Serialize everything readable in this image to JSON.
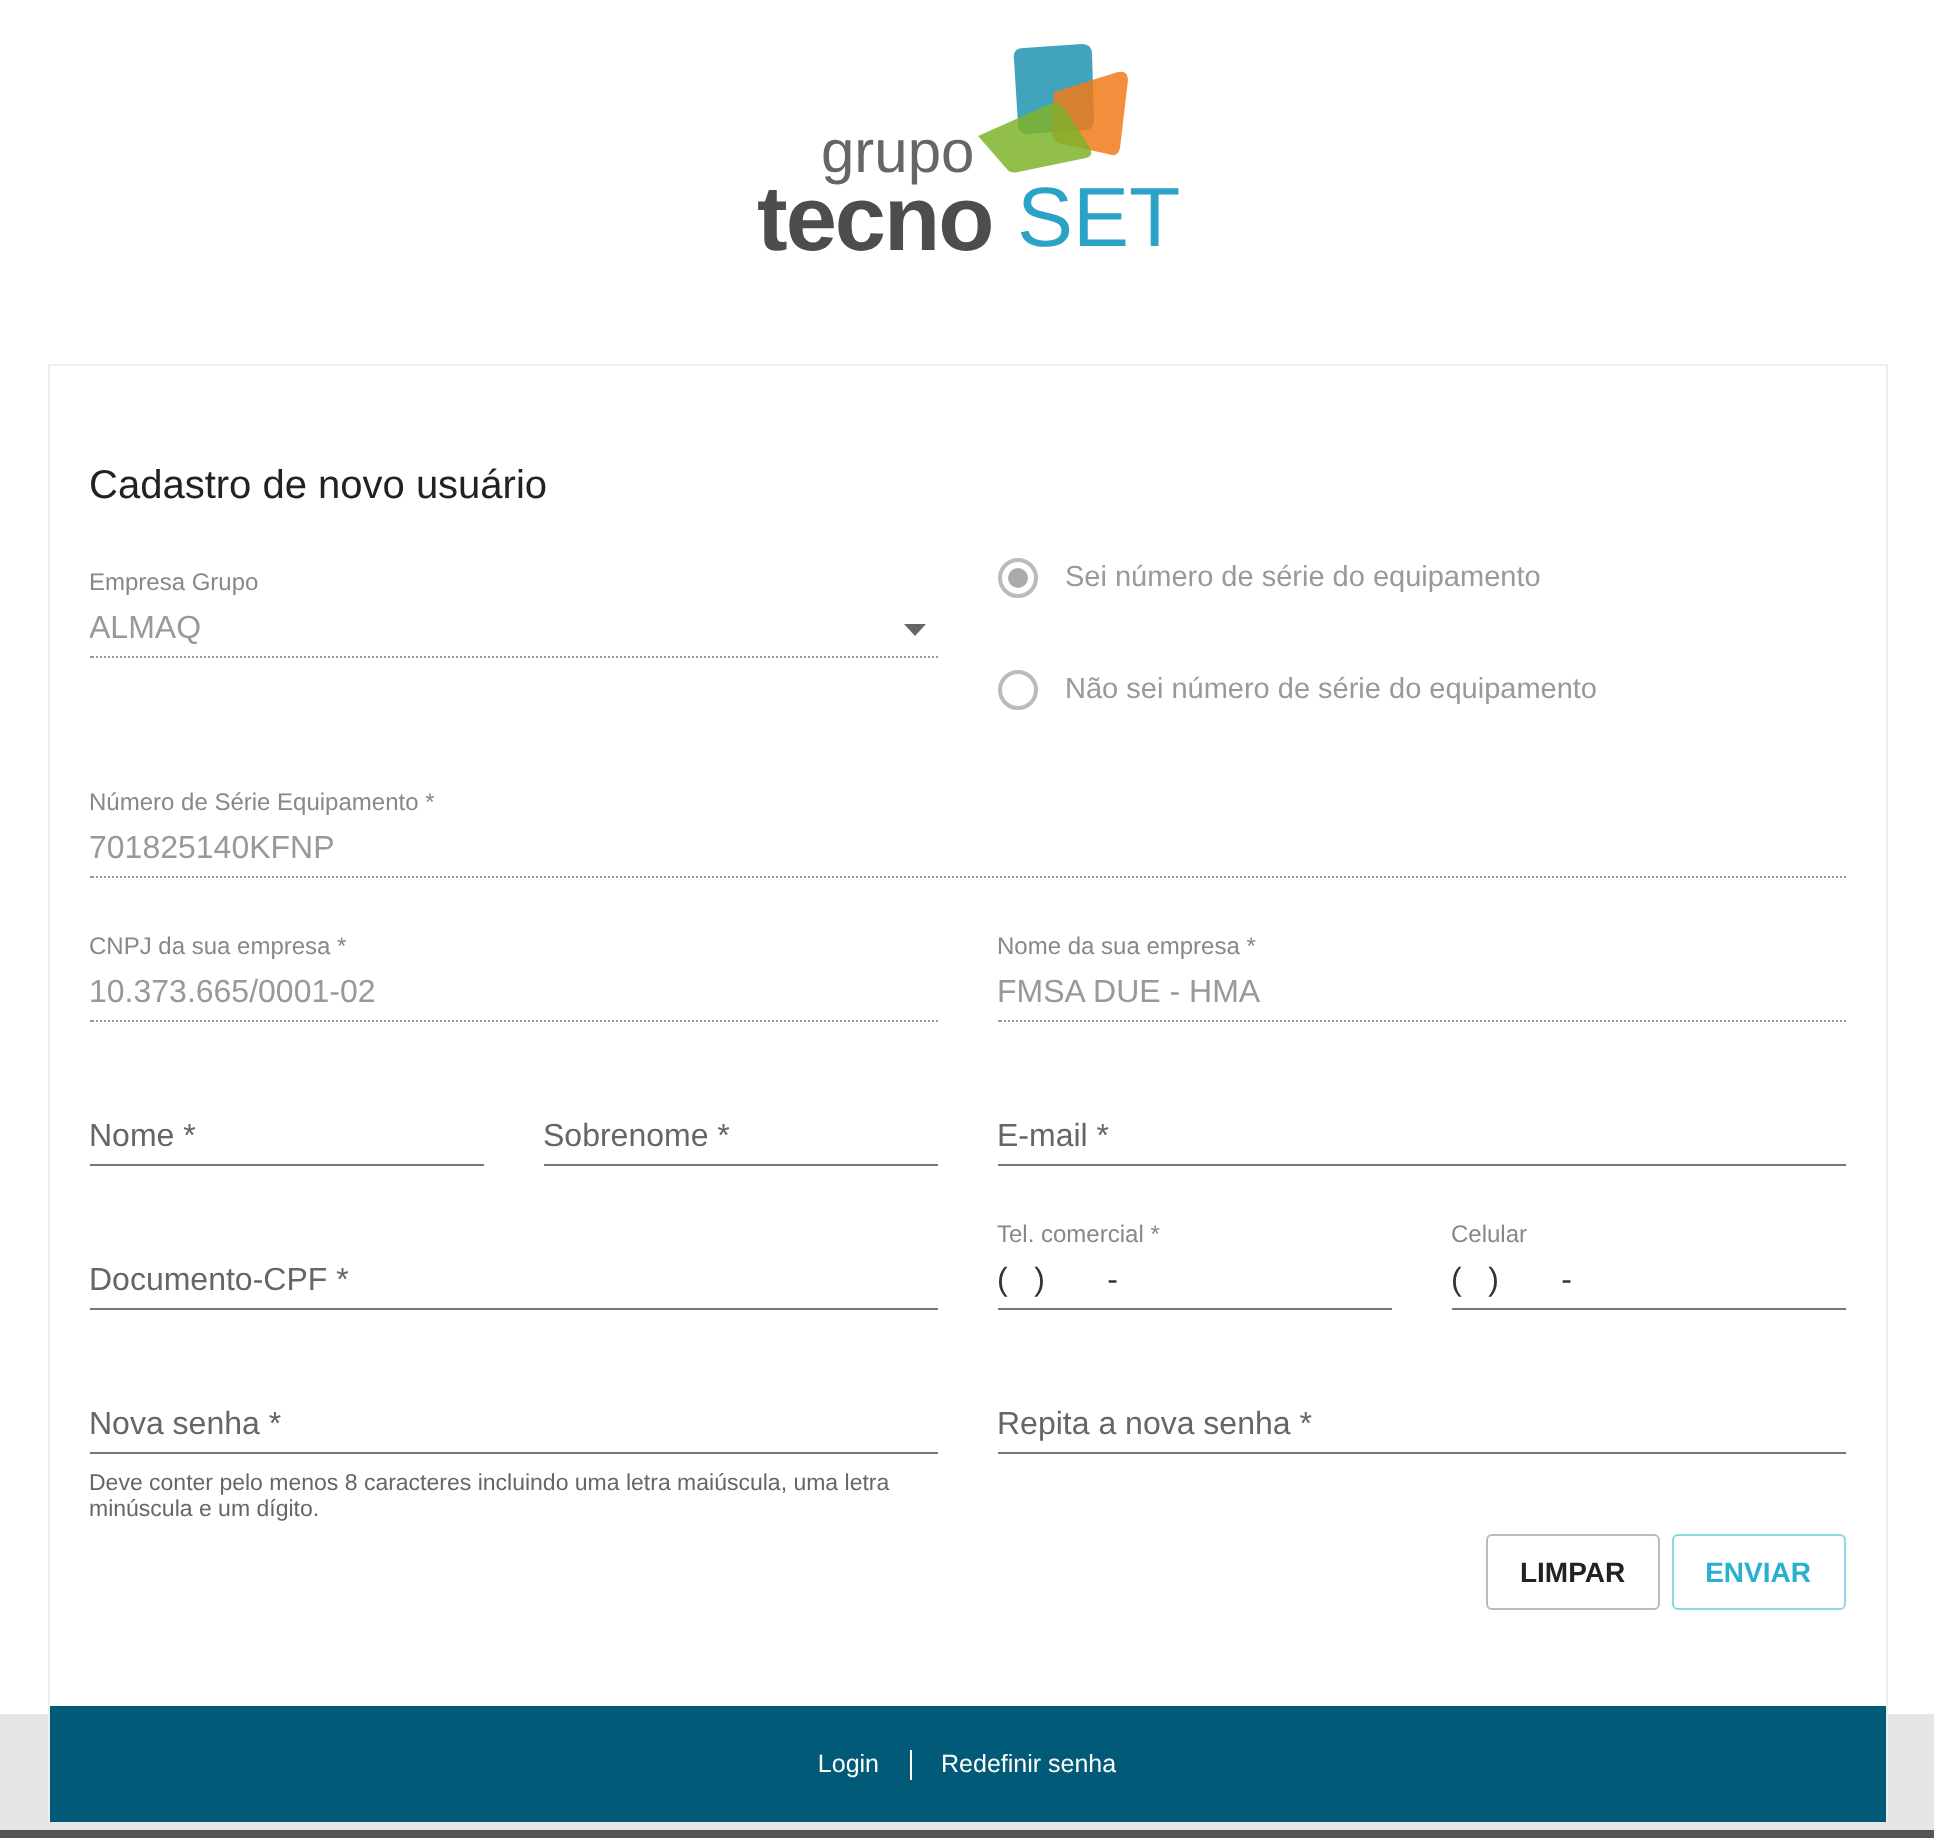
{
  "logo": {
    "line1": "grupo",
    "part1": "tecno",
    "part2": "SET"
  },
  "form": {
    "title": "Cadastro de novo usuário",
    "rows": [
      {
        "cells": [
          {
            "kind": "select",
            "label": "Empresa Grupo",
            "value": "ALMAQ",
            "disabled": true
          },
          {
            "kind": "radios",
            "disabled": true,
            "options": [
              {
                "label": "Sei número de série do equipamento",
                "selected": true
              },
              {
                "label": "Não sei número de série do equipamento",
                "selected": false
              }
            ]
          }
        ]
      },
      {
        "cells": [
          {
            "kind": "input",
            "label": "Número de Série Equipamento *",
            "value": "701825140KFNP",
            "disabled": true
          }
        ]
      },
      {
        "cells": [
          {
            "kind": "input",
            "label": "CNPJ da sua empresa *",
            "value": "10.373.665/0001-02",
            "disabled": true
          },
          {
            "kind": "input",
            "label": "Nome da sua empresa *",
            "value": "FMSA DUE - HMA",
            "disabled": true
          }
        ]
      },
      {
        "cells": [
          {
            "kind": "pair",
            "fields": [
              {
                "kind": "input",
                "placeholder": "Nome *",
                "disabled": false
              },
              {
                "kind": "input",
                "placeholder": "Sobrenome *",
                "disabled": false
              }
            ]
          },
          {
            "kind": "input",
            "placeholder": "E-mail *",
            "disabled": false
          }
        ]
      },
      {
        "cells": [
          {
            "kind": "input",
            "placeholder": "Documento-CPF *",
            "disabled": false
          },
          {
            "kind": "pair",
            "fields": [
              {
                "kind": "input",
                "label": "Tel. comercial *",
                "value": "(   )       -",
                "disabled": false
              },
              {
                "kind": "input",
                "label": "Celular",
                "value": "(   )       -",
                "disabled": false
              }
            ]
          }
        ]
      },
      {
        "cells": [
          {
            "kind": "input",
            "placeholder": "Nova senha *",
            "disabled": false,
            "hint": "Deve conter pelo menos 8 caracteres incluindo uma letra maiúscula, uma letra minúscula e um dígito."
          },
          {
            "kind": "input",
            "placeholder": "Repita a nova senha *",
            "disabled": false
          }
        ]
      }
    ],
    "buttons": [
      {
        "label": "LIMPAR",
        "kind": "secondary"
      },
      {
        "label": "ENVIAR",
        "kind": "primary"
      }
    ]
  },
  "footer": {
    "links": [
      "Login",
      "Redefinir senha"
    ]
  }
}
